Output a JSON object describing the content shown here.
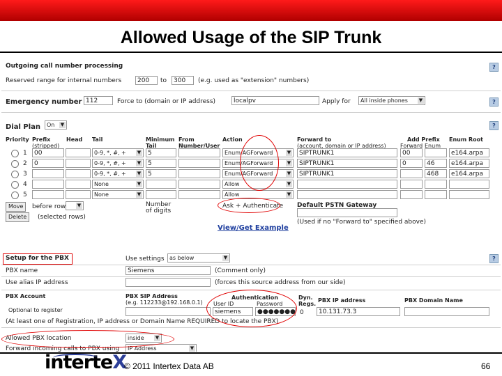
{
  "title": "Allowed Usage of the SIP Trunk",
  "panel1": {
    "outgoing": {
      "label": "Outgoing call number processing",
      "reserved_label": "Reserved range for internal numbers",
      "from": "200",
      "to_label": "to",
      "to": "300",
      "hint": "(e.g. used as \"extension\" numbers)"
    },
    "emergency": {
      "label": "Emergency number",
      "value": "112",
      "force_label": "Force to (domain or IP address)",
      "force_value": "localpv",
      "apply_label": "Apply for",
      "apply_value": "All inside phones"
    },
    "dialplan": {
      "label": "Dial Plan",
      "value": "On"
    },
    "headers": {
      "priority": "Priority",
      "prefix": "Prefix",
      "stripped": "(stripped)",
      "head": "Head",
      "tail": "Tail",
      "min": "Minimum",
      "min2": "Tail",
      "from": "From",
      "from2": "Number/User",
      "action": "Action",
      "fwd": "Forward to",
      "fwd2": "(account, domain or IP address)",
      "addprefix": "Add Prefix",
      "forward": "Forward",
      "enum": "Enum",
      "enumroot": "Enum Root"
    },
    "rows": [
      {
        "n": "1",
        "prefix": "00",
        "tail": "0-9, *, #, +",
        "min": "5",
        "action": "Enum/AGForward",
        "fwd": "SIPTRUNK1",
        "fwdp": "00",
        "enump": "",
        "root": "e164.arpa"
      },
      {
        "n": "2",
        "prefix": "0",
        "tail": "0-9, *, #, +",
        "min": "5",
        "action": "Enum/AGForward",
        "fwd": "SIPTRUNK1",
        "fwdp": "0",
        "enump": "46",
        "root": "e164.arpa"
      },
      {
        "n": "3",
        "prefix": "",
        "tail": "0-9, *, #, +",
        "min": "5",
        "action": "Enum/AGForward",
        "fwd": "SIPTRUNK1",
        "fwdp": "",
        "enump": "468",
        "root": "e164.arpa"
      },
      {
        "n": "4",
        "prefix": "",
        "tail": "None",
        "min": "",
        "action": "Allow",
        "fwd": "",
        "fwdp": "",
        "enump": "",
        "root": ""
      },
      {
        "n": "5",
        "prefix": "",
        "tail": "None",
        "min": "",
        "action": "Allow",
        "fwd": "",
        "fwdp": "",
        "enump": "",
        "root": ""
      }
    ],
    "move_btn": "Move",
    "before_row": "before row",
    "delete_btn": "Delete",
    "selected_rows": "(selected rows)",
    "min_note": "Number of digits",
    "action_note": "Ask + Authenticate",
    "default_gw": "Default PSTN Gateway",
    "gw_note": "(Used if no \"Forward to\" specified above)",
    "example_link": "View/Get Example"
  },
  "panel2": {
    "setup_label": "Setup for the PBX",
    "use_settings_label": "Use settings",
    "use_settings_value": "as below",
    "pbx_name_label": "PBX name",
    "pbx_name_value": "Siemens",
    "pbx_name_hint": "(Comment only)",
    "alias_label": "Use alias IP address",
    "alias_hint": "(forces this source address from our side)",
    "account_label": "PBX Account",
    "account_sub": "Optional to register",
    "sip_addr_label": "PBX SIP Address",
    "sip_addr_hint": "(e.g. 112233@192.168.0.1)",
    "auth_label": "Authentication",
    "userid_label": "User ID",
    "password_label": "Password",
    "userid_value": "siemens",
    "password_value": "●●●●●●●●",
    "dyn_regs_label": "Dyn. Regs.",
    "dyn_regs_value": "0",
    "ip_label": "PBX IP address",
    "ip_value": "10.131.73.3",
    "domain_label": "PBX Domain Name",
    "required_note": "(At least one of Registration, IP address or Domain Name REQUIRED to locate the PBX)",
    "location_label": "Allowed PBX location",
    "location_value": "inside",
    "forward_label": "Forward incoming calls to PBX using",
    "forward_value": "IP Address"
  },
  "footer": {
    "logo_main": "interte",
    "logo_x": "X",
    "copyright": "© 2011 Intertex Data AB",
    "page": "66"
  },
  "colors": {
    "top_bar": "#cc0000",
    "highlight": "#e00000",
    "logo_accent": "#2c3e98"
  }
}
